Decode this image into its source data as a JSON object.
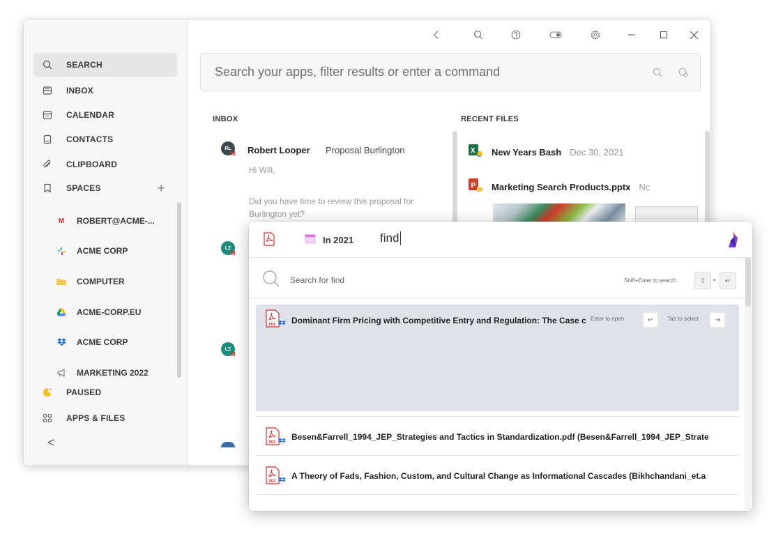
{
  "sidebar": {
    "items": [
      {
        "label": "SEARCH",
        "icon": "search-icon"
      },
      {
        "label": "INBOX",
        "icon": "inbox-icon"
      },
      {
        "label": "CALENDAR",
        "icon": "calendar-icon"
      },
      {
        "label": "CONTACTS",
        "icon": "contacts-icon"
      },
      {
        "label": "CLIPBOARD",
        "icon": "paperclip-icon"
      },
      {
        "label": "SPACES",
        "icon": "bookmark-icon"
      }
    ],
    "spaces": [
      {
        "label": "ROBERT@ACME-...",
        "icon": "gmail-icon"
      },
      {
        "label": "ACME CORP",
        "icon": "slack-icon"
      },
      {
        "label": "COMPUTER",
        "icon": "folder-icon"
      },
      {
        "label": "ACME-CORP.EU",
        "icon": "google-drive-icon"
      },
      {
        "label": "ACME CORP",
        "icon": "dropbox-icon"
      },
      {
        "label": "MARKETING 2022",
        "icon": "megaphone-icon"
      }
    ],
    "bottom": [
      {
        "label": "PAUSED",
        "icon": "moon-icon"
      },
      {
        "label": "APPS & FILES",
        "icon": "apps-grid-icon"
      }
    ],
    "add_symbol": "+",
    "collapse_symbol": "<"
  },
  "search": {
    "placeholder": "Search your apps, filter results or enter a command"
  },
  "inbox": {
    "title": "INBOX",
    "messages": [
      {
        "initials": "RL",
        "from": "Robert Looper",
        "subject": "Proposal Burlington",
        "body_line1": "Hi Will,",
        "body_line2": "Did you have time to review this proposal for",
        "body_line3": "Burlington yet?"
      },
      {
        "initials": "LZ"
      },
      {
        "initials": "LZ"
      }
    ]
  },
  "recent_files": {
    "title": "RECENT FILES",
    "files": [
      {
        "name": "New Years Bash",
        "date": "Dec 30, 2021",
        "icon": "excel-icon"
      },
      {
        "name": "Marketing Search Products.pptx",
        "date": "Nc",
        "icon": "powerpoint-icon"
      }
    ]
  },
  "popup": {
    "filter_chip": "In 2021",
    "query": "find",
    "search_placeholder": "Search for find",
    "search_hint": "Shift+Enter to search",
    "key_shift": "⇧",
    "key_plus": "+",
    "key_enter": "↵",
    "key_tab": "⇥",
    "open_hint": "Enter to open",
    "select_hint": "Tab to select",
    "results": [
      {
        "title": "Dominant Firm Pricing with Competitive Entry and Regulation: The Case c"
      },
      {
        "title": "Besen&Farrell_1994_JEP_Strategies and Tactics in Standardization.pdf (Besen&Farrell_1994_JEP_Strate"
      },
      {
        "title": "A Theory of Fads, Fashion, Custom, and Cultural Change as Informational Cascades (Bikhchandani_et.a"
      }
    ]
  },
  "colors": {
    "accent_purple": "#6b3fd4",
    "pdf_red": "#d32f2f",
    "dropbox_blue": "#0061fe",
    "selected_row": "#dfe3e9"
  }
}
